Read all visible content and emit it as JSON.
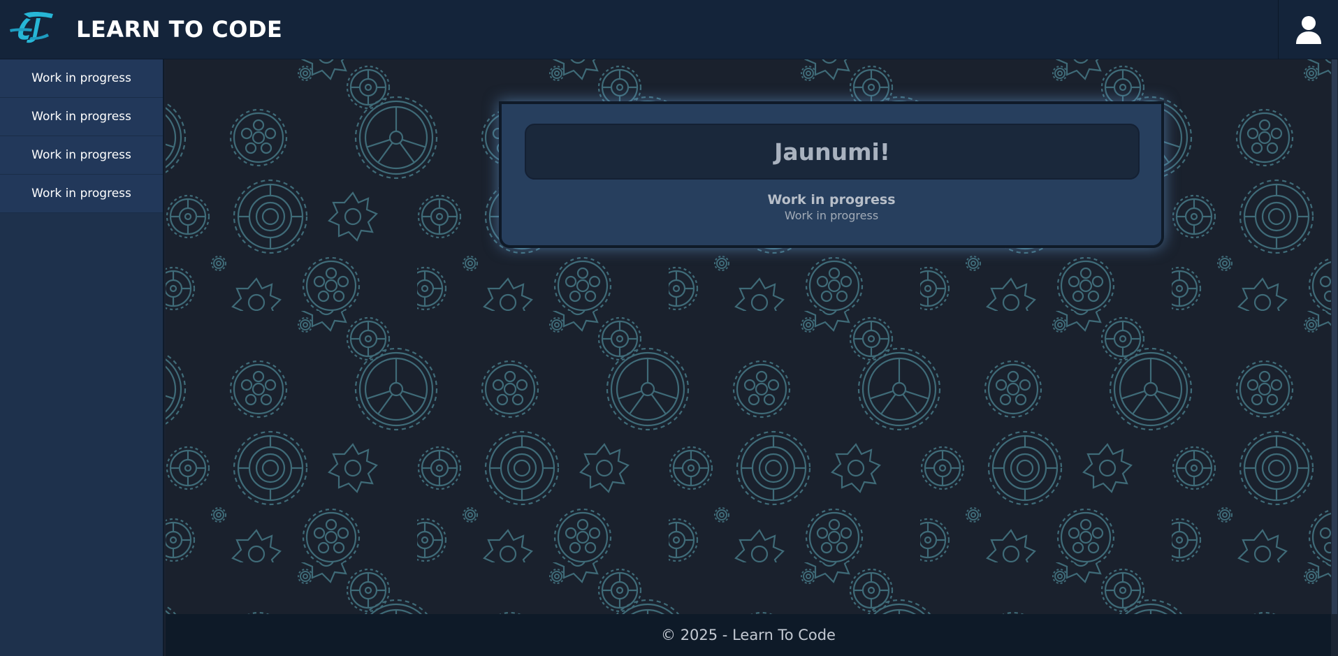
{
  "header": {
    "app_title": "LEARN TO CODE",
    "logo_icon": "ltc-logo-icon",
    "profile_icon": "user-icon"
  },
  "sidebar": {
    "items": [
      {
        "label": "Work in progress"
      },
      {
        "label": "Work in progress"
      },
      {
        "label": "Work in progress"
      },
      {
        "label": "Work in progress"
      }
    ]
  },
  "news_card": {
    "title": "Jaunumi!",
    "item_title": "Work in progress",
    "item_text": "Work in progress"
  },
  "footer": {
    "copyright": "© 2025 - Learn To Code"
  },
  "colors": {
    "header_bg": "#14243a",
    "sidebar_bg": "#1e314c",
    "card_bg": "#273f5e",
    "gear_stroke": "#3f6b78",
    "logo_accent": "#27b6d6"
  }
}
